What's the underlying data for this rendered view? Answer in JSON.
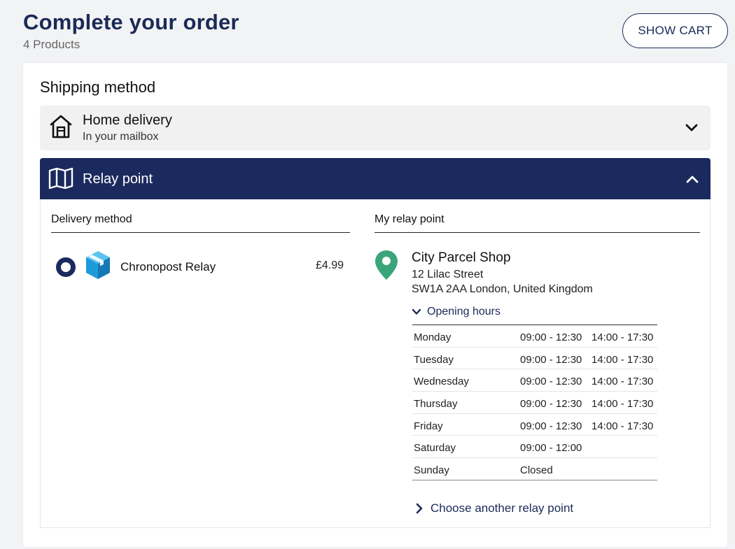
{
  "header": {
    "title": "Complete your order",
    "subtitle": "4 Products",
    "show_cart_label": "SHOW CART"
  },
  "shipping": {
    "title": "Shipping method",
    "home_delivery": {
      "title": "Home delivery",
      "subtitle": "In your mailbox",
      "icon": "house-icon",
      "expanded": false
    },
    "relay_point": {
      "title": "Relay point",
      "icon": "map-icon",
      "expanded": true,
      "delivery_method_heading": "Delivery method",
      "my_relay_heading": "My relay point",
      "method": {
        "name": "Chronopost Relay",
        "price": "£4.99",
        "selected": true,
        "icon": "box-icon"
      },
      "shop": {
        "name": "City Parcel Shop",
        "address_line1": "12 Lilac Street",
        "address_line2": "SW1A 2AA London, United Kingdom",
        "icon": "location-pin-icon"
      },
      "opening_hours_label": "Opening hours",
      "hours": [
        {
          "day": "Monday",
          "am": "09:00 - 12:30",
          "pm": "14:00 - 17:30"
        },
        {
          "day": "Tuesday",
          "am": "09:00 - 12:30",
          "pm": "14:00 - 17:30"
        },
        {
          "day": "Wednesday",
          "am": "09:00 - 12:30",
          "pm": "14:00 - 17:30"
        },
        {
          "day": "Thursday",
          "am": "09:00 - 12:30",
          "pm": "14:00 - 17:30"
        },
        {
          "day": "Friday",
          "am": "09:00 - 12:30",
          "pm": "14:00 - 17:30"
        },
        {
          "day": "Saturday",
          "am": "09:00 - 12:00",
          "pm": ""
        },
        {
          "day": "Sunday",
          "am": "Closed",
          "pm": ""
        }
      ],
      "choose_another_label": "Choose another relay point"
    }
  },
  "colors": {
    "brand_navy": "#1b2a5e",
    "pin_green": "#3aa57a",
    "box_blue": "#1d9bd8"
  }
}
